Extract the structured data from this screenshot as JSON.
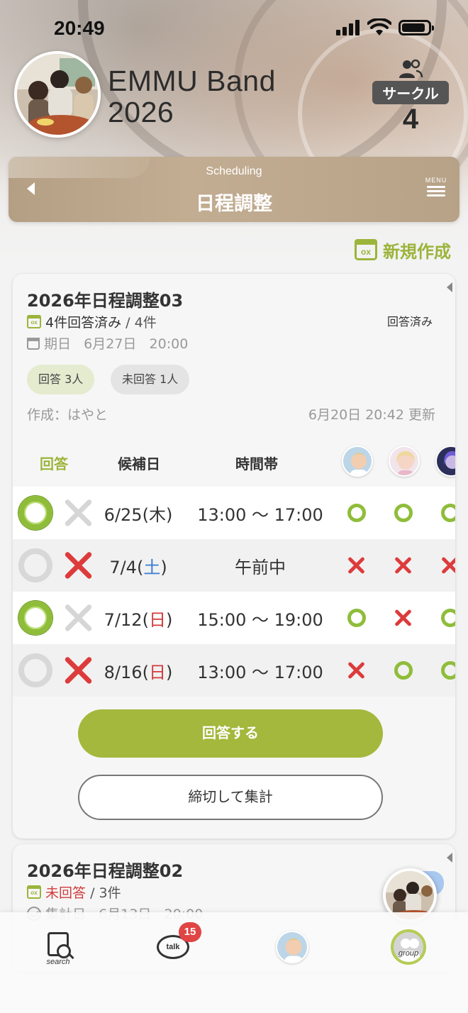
{
  "status_bar": {
    "time": "20:49"
  },
  "header": {
    "group_name_line1": "EMMU Band",
    "group_name_line2": "2026",
    "circle_label": "サークル",
    "member_count": "4"
  },
  "banner": {
    "subtitle": "Scheduling",
    "title": "日程調整",
    "menu_label": "MENU"
  },
  "new_button_label": "新規作成",
  "new_button_icon_text": "ox",
  "cards": [
    {
      "title": "2026年日程調整03",
      "answered_text": "4件回答済み",
      "total_text": " / 4件",
      "deadline_label": "期日",
      "deadline_date": "6月27日",
      "deadline_time": "20:00",
      "status": "回答済み",
      "answered_pill": "回答 3人",
      "unanswered_pill": "未回答 1人",
      "creator": "作成：はやと",
      "updated": "6月20日 20:42 更新",
      "table_headers": {
        "answer": "回答",
        "date": "候補日",
        "time": "時間帯"
      },
      "rows": [
        {
          "date": "6/25",
          "day": "木",
          "day_type": "weekday",
          "time": "13:00 〜 17:00",
          "my_answer": "o",
          "members": [
            "o",
            "o",
            "o"
          ]
        },
        {
          "date": "7/4",
          "day": "土",
          "day_type": "sat",
          "time": "午前中",
          "my_answer": "x",
          "members": [
            "x",
            "x",
            "x"
          ]
        },
        {
          "date": "7/12",
          "day": "日",
          "day_type": "sun",
          "time": "15:00 〜 19:00",
          "my_answer": "o",
          "members": [
            "o",
            "x",
            "o"
          ]
        },
        {
          "date": "8/16",
          "day": "日",
          "day_type": "sun",
          "time": "13:00 〜 17:00",
          "my_answer": "x",
          "members": [
            "x",
            "o",
            "o"
          ]
        }
      ],
      "answer_button": "回答する",
      "close_button": "締切して集計"
    },
    {
      "title": "2026年日程調整02",
      "unanswered_text": "未回答",
      "total_text": " / 3件",
      "deadline_label": "集計日",
      "deadline_date": "6月13日",
      "deadline_time": "20:00"
    }
  ],
  "tabbar": {
    "search_label": "search",
    "talk_label": "talk",
    "talk_badge": "15",
    "group_label": "group"
  },
  "colors": {
    "accent_green": "#a3b83c",
    "ok_green": "#8fbd3a",
    "ng_red": "#dd3b3b",
    "banner_tan": "#c2ad92"
  }
}
